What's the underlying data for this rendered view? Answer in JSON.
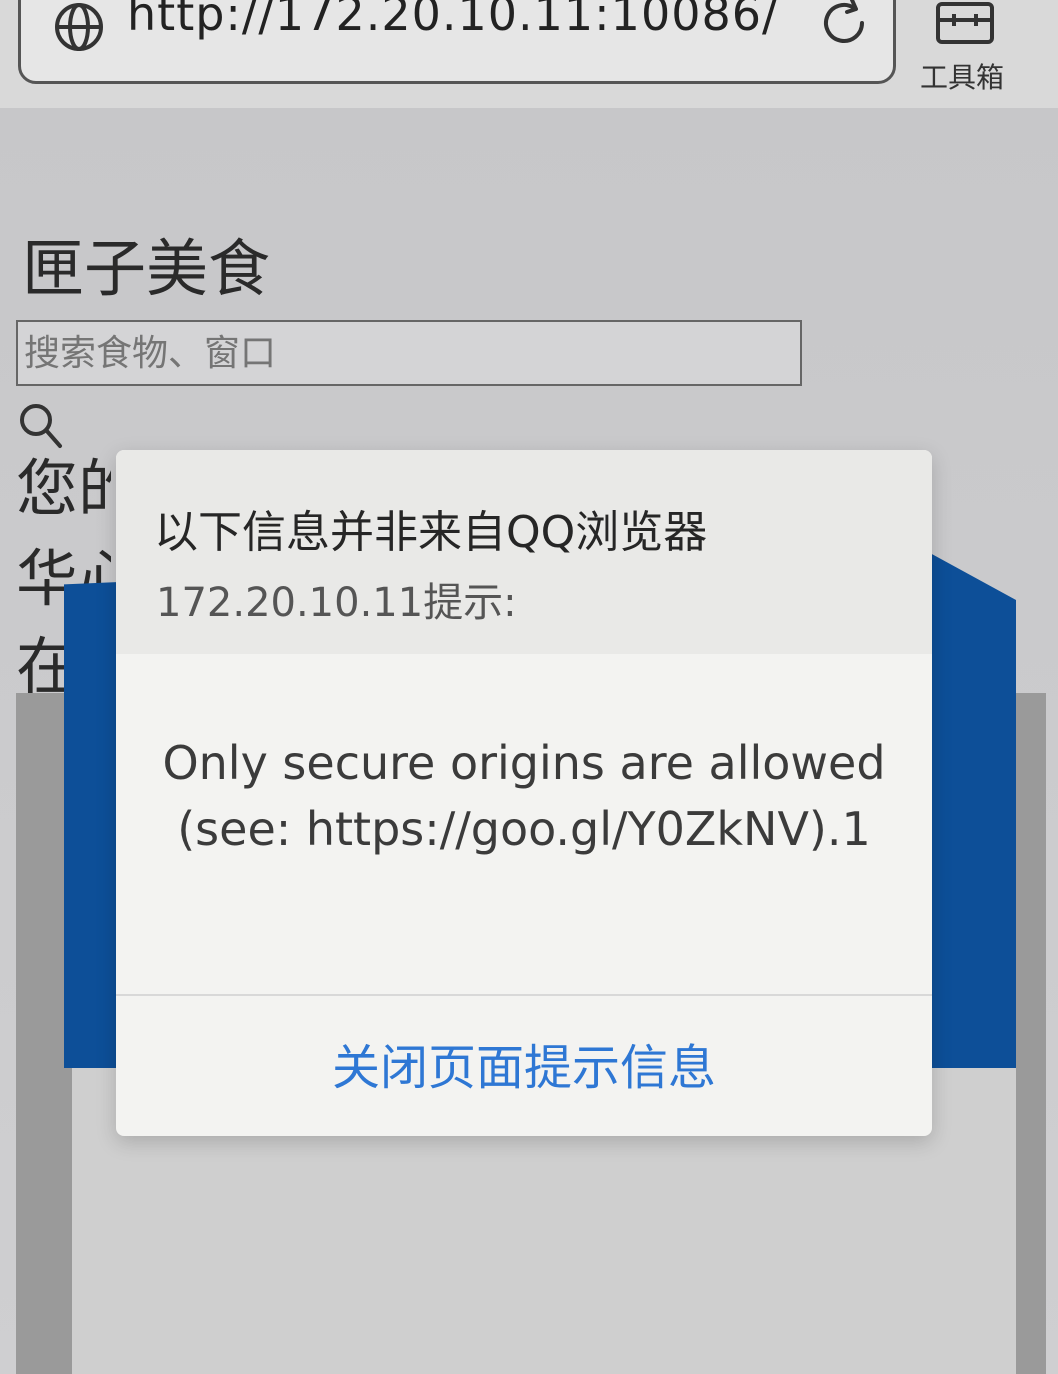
{
  "browser": {
    "url": "http://172.20.10.11:10086/",
    "toolbox_label": "工具箱"
  },
  "page": {
    "site_title": "匣子美食",
    "search_placeholder": "搜索食物、窗口",
    "partial_lines": [
      "您的",
      "华心",
      "在线"
    ]
  },
  "dialog": {
    "warning": "以下信息并非来自QQ浏览器",
    "origin": "172.20.10.11提示:",
    "message": "Only secure origins are allowed (see: https://goo.gl/Y0ZkNV).1",
    "close_label": "关闭页面提示信息"
  },
  "colors": {
    "link_blue": "#2e77d4",
    "banner_blue": "#0d4f98"
  }
}
